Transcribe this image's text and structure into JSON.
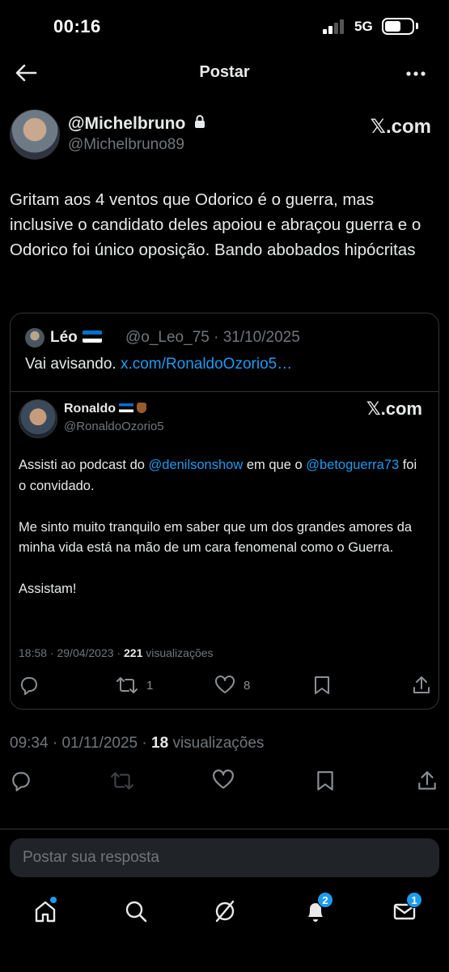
{
  "status": {
    "time": "00:16",
    "network": "5G"
  },
  "header": {
    "title": "Postar"
  },
  "post": {
    "author_name": "@Michelbruno",
    "author_handle": "@Michelbruno89",
    "source_label": "𝕏.com",
    "text": "Gritam aos 4 ventos que Odorico é o guerra, mas inclusive o candidato deles apoiou e abraçou guerra e o Odorico foi único  oposição. Bando abobados hipócritas",
    "time": "09:34",
    "date": "01/11/2025",
    "views_count": "18",
    "views_label": "visualizações"
  },
  "quote": {
    "author_name": "Léo",
    "meta": "@o_Leo_75 · 31/10/2025",
    "text": "Vai avisando.",
    "link": "x.com/RonaldoOzorio5…"
  },
  "embedded": {
    "author_name": "Ronaldo",
    "author_handle": "@RonaldoOzorio5",
    "source_label": "𝕏.com",
    "p1_a": "Assisti ao podcast do ",
    "p1_mention1": "@denilsonshow",
    "p1_b": " em que o ",
    "p1_mention2": "@betoguerra73",
    "p1_c": " foi o convidado.",
    "p2": "Me sinto muito tranquilo em saber que um dos grandes amores da minha vida está na mão de um cara fenomenal como o Guerra.",
    "p3": "Assistam!",
    "time_date": "18:58 · 29/04/2023 · ",
    "views_count": "221",
    "views_label": "visualizações",
    "retweets": "1",
    "likes": "8"
  },
  "reply": {
    "placeholder": "Postar sua resposta"
  },
  "tabbar": {
    "notifications_badge": "2",
    "messages_badge": "1"
  },
  "colors": {
    "accent": "#1d9bf0",
    "text": "#e7e9ea",
    "muted": "#71767b",
    "border": "#2f3336"
  }
}
